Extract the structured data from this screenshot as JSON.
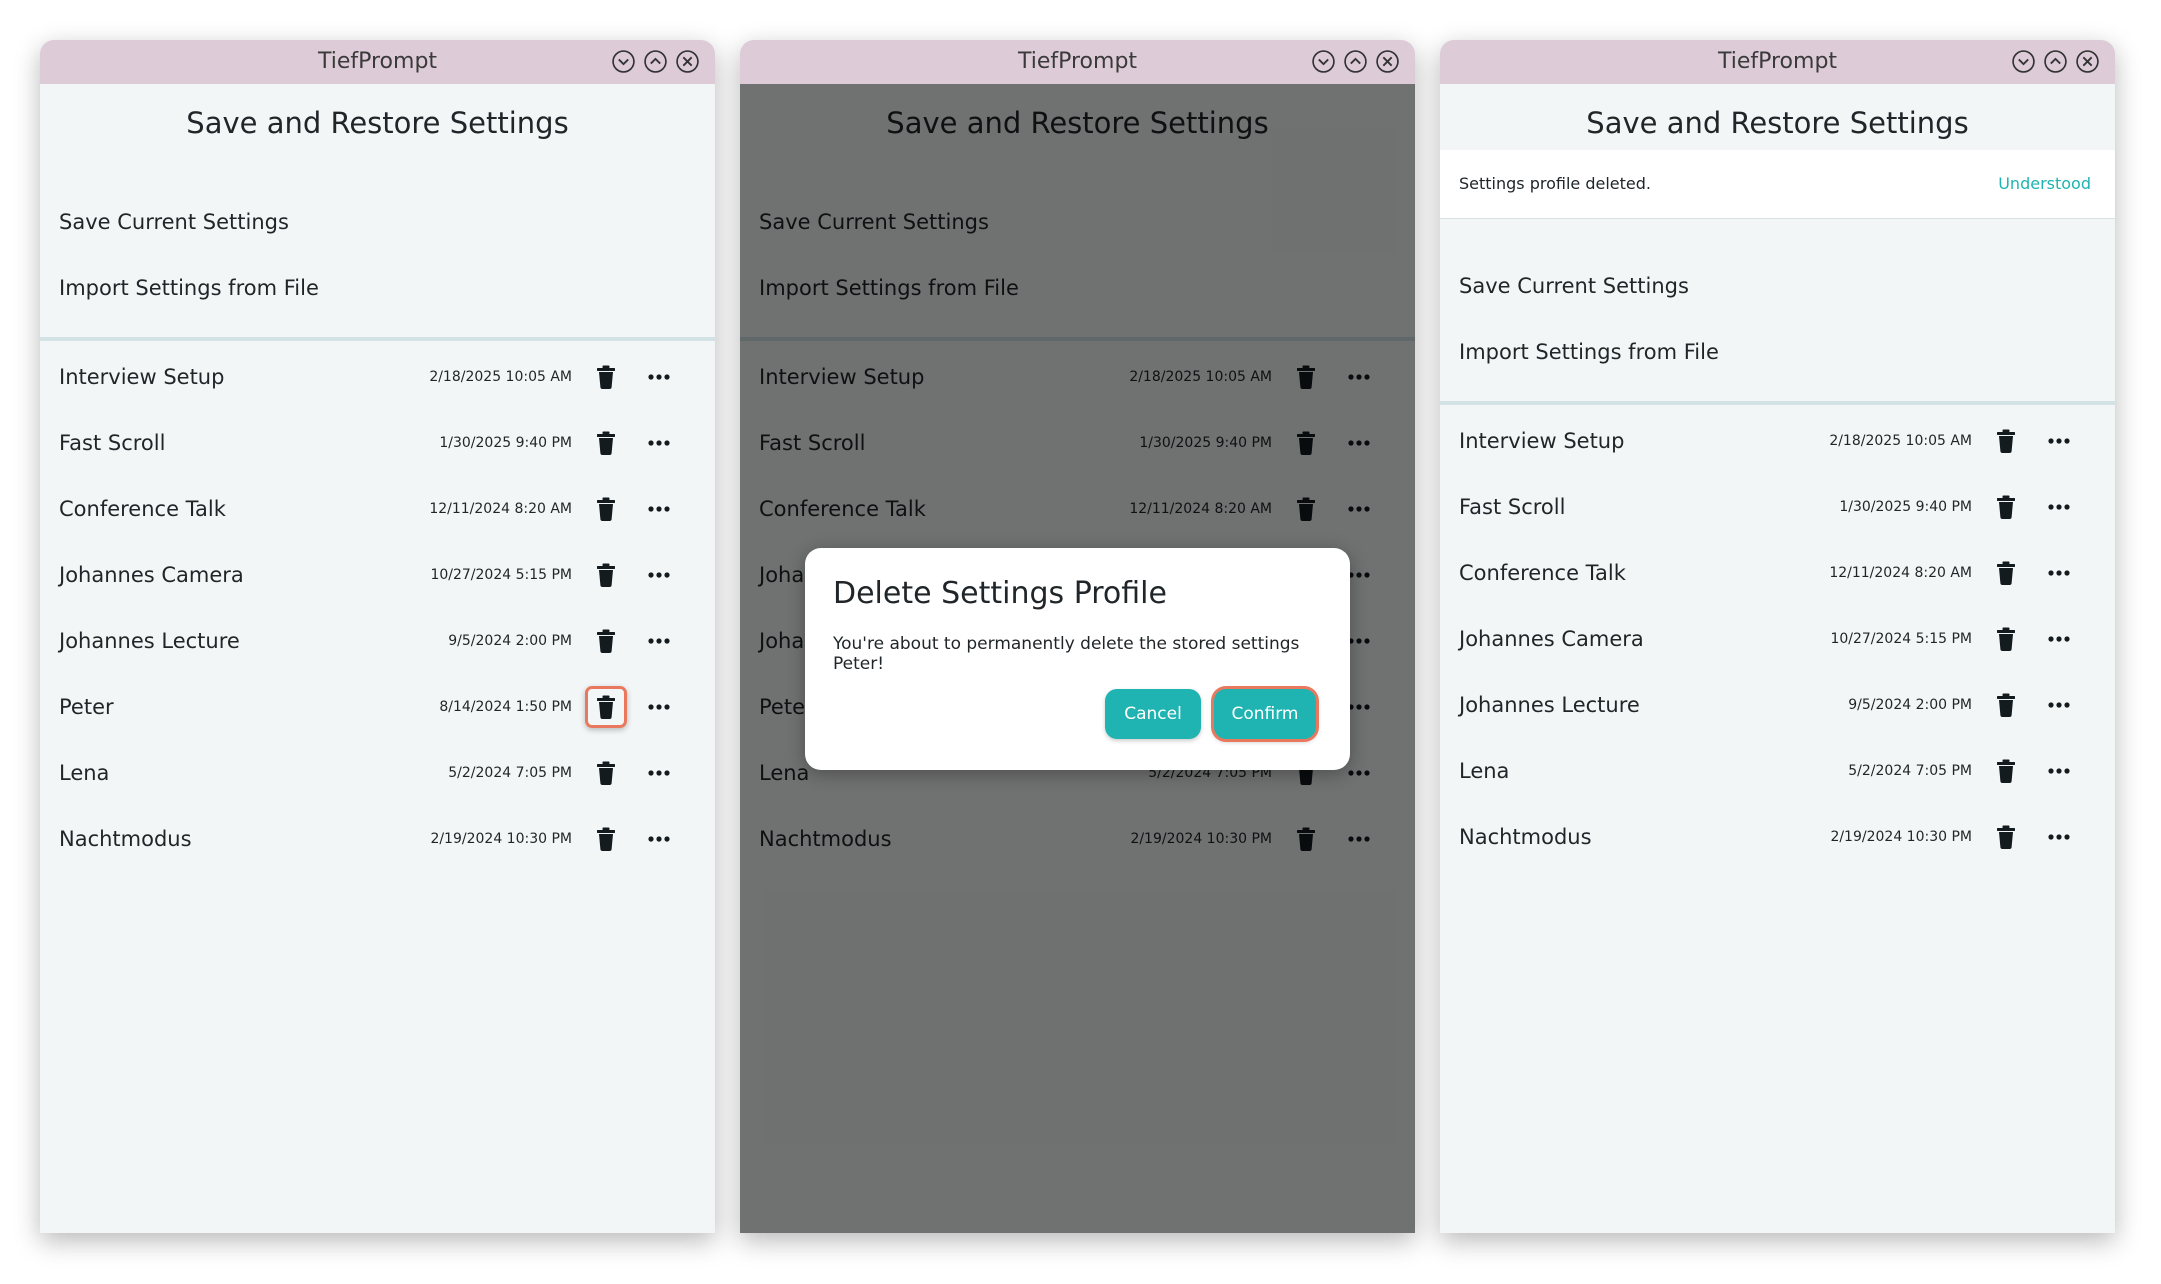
{
  "app_title": "TiefPrompt",
  "page_title": "Save and Restore Settings",
  "actions": {
    "save_current": "Save Current Settings",
    "import_file": "Import Settings from File"
  },
  "profiles_before": [
    {
      "name": "Interview Setup",
      "date": "2/18/2025 10:05 AM"
    },
    {
      "name": "Fast Scroll",
      "date": "1/30/2025 9:40 PM"
    },
    {
      "name": "Conference Talk",
      "date": "12/11/2024 8:20 AM"
    },
    {
      "name": "Johannes Camera",
      "date": "10/27/2024 5:15 PM"
    },
    {
      "name": "Johannes Lecture",
      "date": "9/5/2024 2:00 PM"
    },
    {
      "name": "Peter",
      "date": "8/14/2024 1:50 PM"
    },
    {
      "name": "Lena",
      "date": "5/2/2024 7:05 PM"
    },
    {
      "name": "Nachtmodus",
      "date": "2/19/2024 10:30 PM"
    }
  ],
  "profiles_after": [
    {
      "name": "Interview Setup",
      "date": "2/18/2025 10:05 AM"
    },
    {
      "name": "Fast Scroll",
      "date": "1/30/2025 9:40 PM"
    },
    {
      "name": "Conference Talk",
      "date": "12/11/2024 8:20 AM"
    },
    {
      "name": "Johannes Camera",
      "date": "10/27/2024 5:15 PM"
    },
    {
      "name": "Johannes Lecture",
      "date": "9/5/2024 2:00 PM"
    },
    {
      "name": "Lena",
      "date": "5/2/2024 7:05 PM"
    },
    {
      "name": "Nachtmodus",
      "date": "2/19/2024 10:30 PM"
    }
  ],
  "dialog": {
    "title": "Delete Settings Profile",
    "message": "You're about to permanently delete the stored settings Peter!",
    "cancel": "Cancel",
    "confirm": "Confirm"
  },
  "snackbar": {
    "message": "Settings profile deleted.",
    "action": "Understood"
  },
  "icons": {
    "titlebar": [
      "minimize-icon",
      "maximize-icon",
      "close-icon"
    ],
    "row": [
      "trash-icon",
      "more-icon"
    ]
  },
  "colors": {
    "titlebar": "#ddccd8",
    "accent": "#1fb3b2",
    "highlight": "#e8795e",
    "background": "#f3f6f7"
  }
}
